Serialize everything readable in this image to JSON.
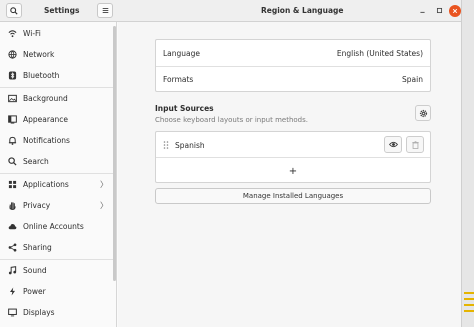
{
  "header": {
    "sidebar_title": "Settings",
    "page_title": "Region & Language",
    "search_icon": "search-icon",
    "menu_icon": "hamburger-menu-icon",
    "window_controls": [
      "minimize",
      "maximize",
      "close"
    ]
  },
  "sidebar": {
    "items": [
      {
        "label": "Wi-Fi",
        "icon": "wifi-icon"
      },
      {
        "label": "Network",
        "icon": "network-icon"
      },
      {
        "label": "Bluetooth",
        "icon": "bluetooth-icon"
      },
      {
        "label": "Background",
        "icon": "background-icon"
      },
      {
        "label": "Appearance",
        "icon": "appearance-icon"
      },
      {
        "label": "Notifications",
        "icon": "bell-icon"
      },
      {
        "label": "Search",
        "icon": "search-icon"
      },
      {
        "label": "Applications",
        "icon": "applications-icon",
        "has_chevron": true
      },
      {
        "label": "Privacy",
        "icon": "privacy-hand-icon",
        "has_chevron": true
      },
      {
        "label": "Online Accounts",
        "icon": "cloud-icon"
      },
      {
        "label": "Sharing",
        "icon": "share-icon"
      },
      {
        "label": "Sound",
        "icon": "music-note-icon"
      },
      {
        "label": "Power",
        "icon": "power-icon"
      },
      {
        "label": "Displays",
        "icon": "display-icon"
      }
    ],
    "chevron": "〉"
  },
  "region": {
    "language_label": "Language",
    "language_value": "English (United States)",
    "formats_label": "Formats",
    "formats_value": "Spain"
  },
  "input_sources": {
    "title": "Input Sources",
    "subtitle": "Choose keyboard layouts or input methods.",
    "options_icon": "gear-icon",
    "sources": [
      {
        "name": "Spanish",
        "drag_icon": "drag-handle-icon",
        "view_icon": "eye-icon",
        "remove_icon": "trash-icon"
      }
    ],
    "add_symbol": "+"
  },
  "manage_button": "Manage Installed Languages",
  "colors": {
    "accent": "#e95420",
    "window_bg": "#fafafa",
    "content_bg": "#f6f6f6",
    "card_bg": "#ffffff"
  }
}
